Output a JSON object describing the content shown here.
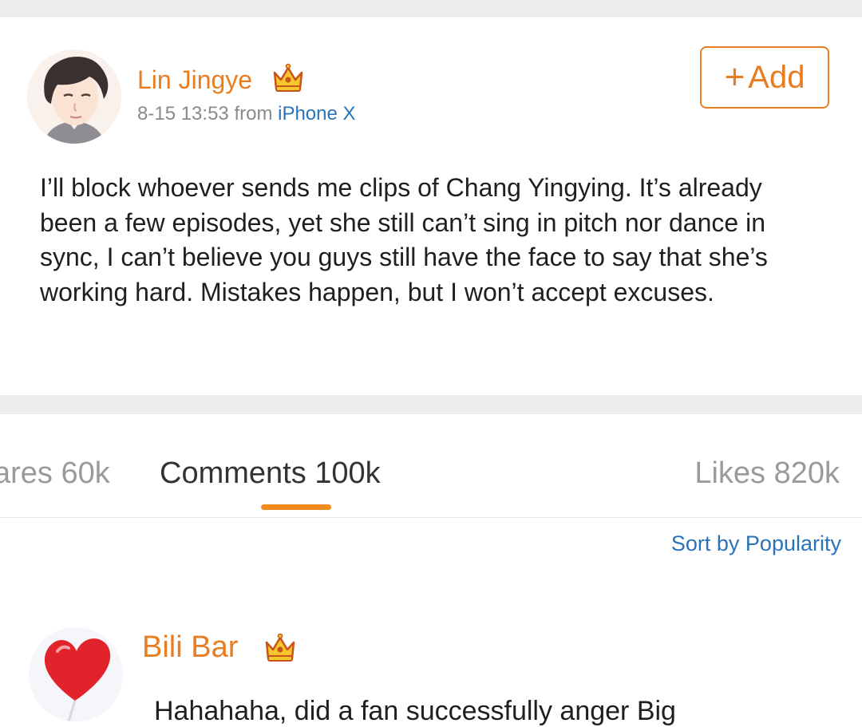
{
  "post": {
    "author": "Lin Jingye",
    "author_badge": "crown-icon",
    "date": "8-15 13:53",
    "from_label": "from",
    "device": "iPhone X",
    "add_label": "Add",
    "body": "I’ll block whoever sends me clips of Chang Yingying. It’s already been a few episodes, yet she still can’t sing in pitch nor dance in sync, I can’t believe you guys still have the face to say that she’s working hard. Mistakes happen, but I won’t accept excuses."
  },
  "tabs": {
    "shares": "ares 60k",
    "comments": "Comments 100k",
    "likes": "Likes 820k",
    "active": "comments"
  },
  "sort_label": "Sort by Popularity",
  "comment": {
    "author": "Bili Bar",
    "author_badge": "crown-icon",
    "text": "Hahahaha, did a fan successfully anger Big"
  },
  "colors": {
    "accent": "#e87d22",
    "link": "#2a73b8",
    "tab_indicator": "#f08c1f",
    "separator": "#ececec"
  }
}
